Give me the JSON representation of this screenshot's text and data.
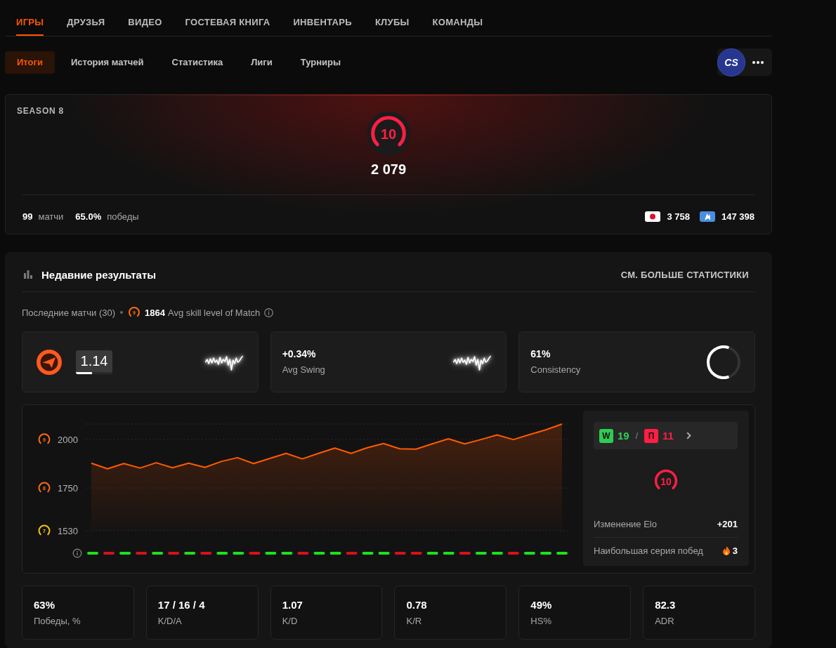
{
  "top_nav": {
    "tabs": [
      {
        "label": "ИГРЫ",
        "selected": true
      },
      {
        "label": "ДРУЗЬЯ",
        "selected": false
      },
      {
        "label": "ВИДЕО",
        "selected": false
      },
      {
        "label": "ГОСТЕВАЯ КНИГА",
        "selected": false
      },
      {
        "label": "ИНВЕНТАРЬ",
        "selected": false
      },
      {
        "label": "КЛУБЫ",
        "selected": false
      },
      {
        "label": "КОМАНДЫ",
        "selected": false
      }
    ]
  },
  "sub_nav": {
    "tabs": [
      {
        "label": "Итоги",
        "selected": true
      },
      {
        "label": "История матчей",
        "selected": false
      },
      {
        "label": "Статистика",
        "selected": false
      },
      {
        "label": "Лиги",
        "selected": false
      },
      {
        "label": "Турниры",
        "selected": false
      }
    ],
    "game_logo": "CS"
  },
  "season": {
    "title": "SEASON 8",
    "level_badge": "10",
    "elo": "2 079",
    "matches": {
      "value": "99",
      "label": "матчи"
    },
    "winrate": {
      "value": "65.0%",
      "label": "победы"
    },
    "rankings": [
      {
        "kind": "country",
        "value": "3 758"
      },
      {
        "kind": "region",
        "value": "147 398"
      }
    ]
  },
  "recent": {
    "title": "Недавние результаты",
    "more_link": "СМ. БОЛЬШЕ СТАТИСТИКИ",
    "matches_label": "Последние матчи (30)",
    "avg_level_badge": "9",
    "avg_elo": "1864",
    "avg_label": "Avg skill level of Match",
    "highlights": [
      {
        "kind": "rating",
        "value": "1.14",
        "level": 0.45
      },
      {
        "kind": "swing",
        "value": "+0.34%",
        "label": "Avg Swing"
      },
      {
        "kind": "consistency",
        "value": "61%",
        "label": "Consistency",
        "level": 0.61
      }
    ],
    "elo_chart": {
      "chart_data": {
        "type": "area",
        "ylim": [
          1530,
          2079
        ],
        "yticks": [
          2000,
          1750,
          1530
        ],
        "values": [
          1878,
          1849,
          1876,
          1853,
          1880,
          1854,
          1878,
          1856,
          1886,
          1906,
          1876,
          1902,
          1928,
          1900,
          1928,
          1955,
          1928,
          1957,
          1979,
          1952,
          1950,
          1977,
          2003,
          1977,
          1999,
          2023,
          1999,
          2025,
          2049,
          2079
        ]
      },
      "tick_badges": [
        {
          "text": "9",
          "color": "#ff6a13"
        },
        {
          "text": "8",
          "color": "#ff6a13"
        },
        {
          "text": "7",
          "color": "#f5c518"
        }
      ],
      "results": [
        {
          "won": true
        },
        {
          "won": false
        },
        {
          "won": true
        },
        {
          "won": false
        },
        {
          "won": true
        },
        {
          "won": false
        },
        {
          "won": true
        },
        {
          "won": false
        },
        {
          "won": true
        },
        {
          "won": true
        },
        {
          "won": false
        },
        {
          "won": true
        },
        {
          "won": true
        },
        {
          "won": false
        },
        {
          "won": true
        },
        {
          "won": true
        },
        {
          "won": false
        },
        {
          "won": true
        },
        {
          "won": true
        },
        {
          "won": false
        },
        {
          "won": false
        },
        {
          "won": true
        },
        {
          "won": true
        },
        {
          "won": false
        },
        {
          "won": true
        },
        {
          "won": true
        },
        {
          "won": false
        },
        {
          "won": true
        },
        {
          "won": true
        },
        {
          "won": true
        }
      ]
    },
    "summary": {
      "wins": {
        "badge": "W",
        "count": "19"
      },
      "separator": "/",
      "losses": {
        "badge": "П",
        "count": "11"
      },
      "level_badge": "10",
      "elo_change": {
        "label": "Изменение Elo",
        "value": "+201"
      },
      "streak": {
        "label": "Наибольшая серия побед",
        "value": "3"
      }
    },
    "stats": [
      {
        "value": "63%",
        "label": "Победы, %"
      },
      {
        "value": "17 / 16 / 4",
        "label": "K/D/A"
      },
      {
        "value": "1.07",
        "label": "K/D"
      },
      {
        "value": "0.78",
        "label": "K/R"
      },
      {
        "value": "49%",
        "label": "HS%"
      },
      {
        "value": "82.3",
        "label": "ADR"
      }
    ]
  }
}
